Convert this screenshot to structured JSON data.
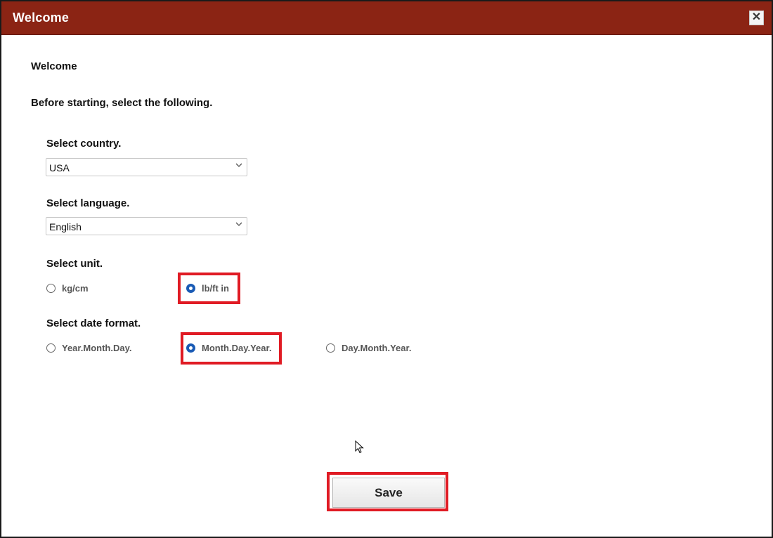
{
  "window": {
    "title": "Welcome",
    "close_glyph": "✕"
  },
  "content": {
    "heading": "Welcome",
    "instruction": "Before starting, select the following."
  },
  "country": {
    "label": "Select country.",
    "selected": "USA"
  },
  "language": {
    "label": "Select language.",
    "selected": "English"
  },
  "unit": {
    "label": "Select unit.",
    "options": [
      {
        "label": "kg/cm",
        "selected": false
      },
      {
        "label": "lb/ft in",
        "selected": true
      }
    ]
  },
  "date_format": {
    "label": "Select date format.",
    "options": [
      {
        "label": "Year.Month.Day.",
        "selected": false
      },
      {
        "label": "Month.Day.Year.",
        "selected": true
      },
      {
        "label": "Day.Month.Year.",
        "selected": false
      }
    ]
  },
  "actions": {
    "save_label": "Save"
  },
  "colors": {
    "titlebar": "#8b2414",
    "radio_selected": "#1a5bb5",
    "highlight": "#e01b24"
  }
}
